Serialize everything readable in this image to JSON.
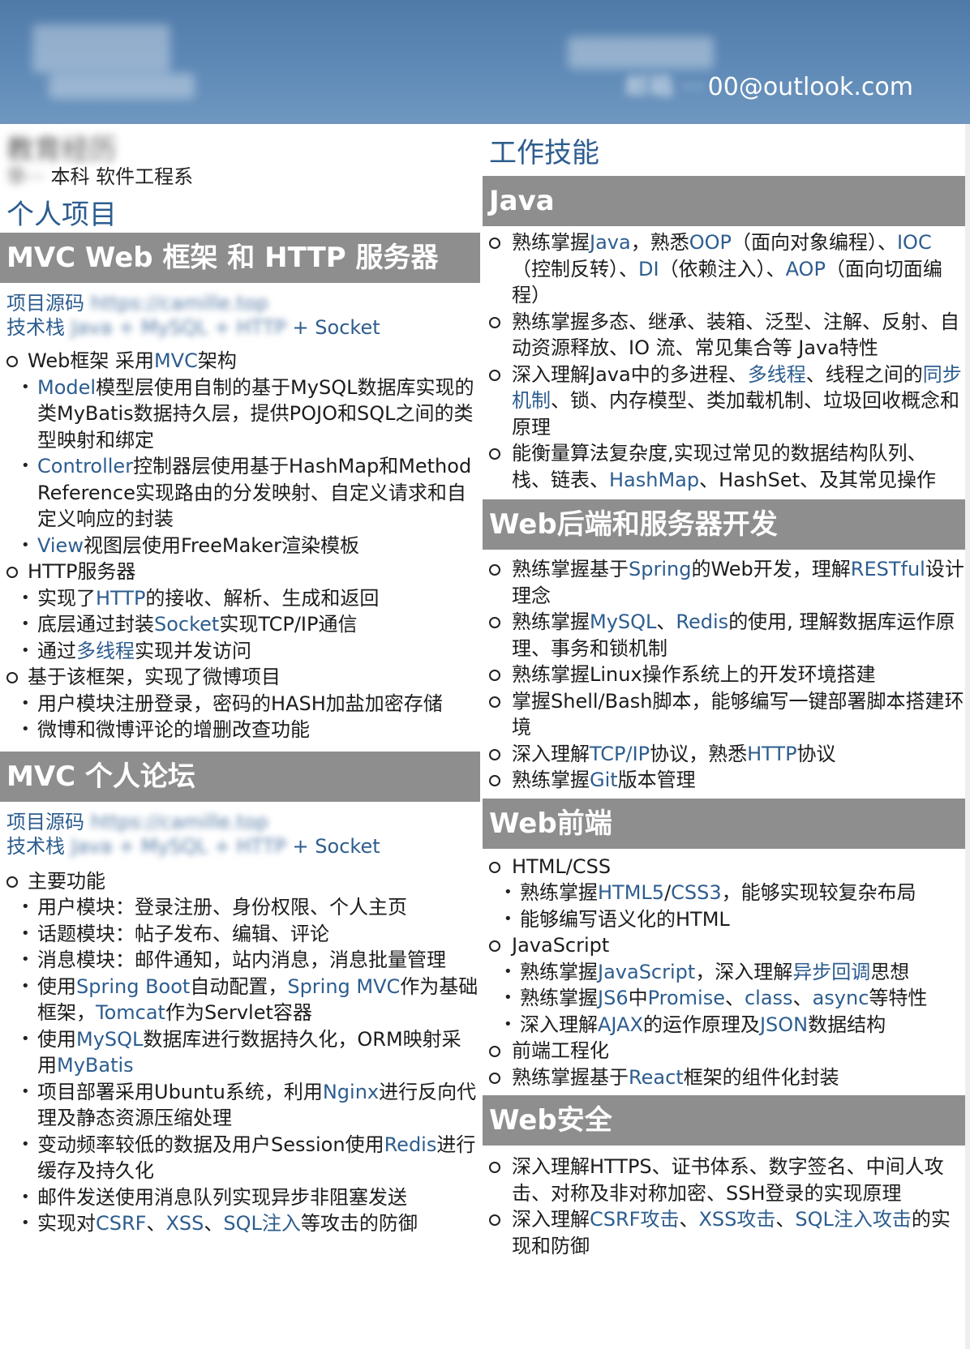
{
  "header": {
    "email_prefix_masked": "邮箱 ···",
    "email": "00@outlook.com"
  },
  "education": {
    "title": "教育经历",
    "detail_masked": "华···",
    "detail": "本科 软件工程系"
  },
  "left": {
    "title": "个人项目",
    "projects": [
      {
        "name": "MVC Web 框架 和 HTTP 服务器",
        "source_label": "项目源码",
        "source_masked": "https://camille.top",
        "stack_label": "技术栈",
        "stack_masked": "Java + MySQL + HTTP",
        "stack_tail": "+ Socket"
      },
      {
        "name": "MVC 个人论坛",
        "source_label": "项目源码",
        "source_masked": "https://camille.top",
        "stack_label": "技术栈",
        "stack_masked": "Java + MySQL + HTTP",
        "stack_tail": "+ Socket"
      }
    ]
  },
  "right": {
    "title": "工作技能",
    "sections": [
      "Java",
      "Web后端和服务器开发",
      "Web前端",
      "Web安全"
    ]
  },
  "colors": {
    "header": "#5f8ab7",
    "section_bar": "#8e8e8e",
    "keyword": "#2d5d8f"
  }
}
